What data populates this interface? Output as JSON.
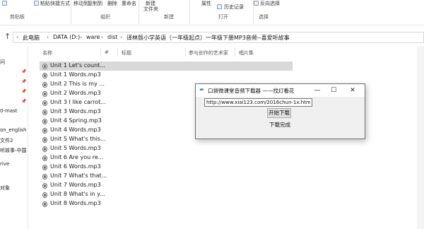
{
  "ribbon": {
    "paste_shortcut": "粘贴快捷方式",
    "move_to": "移动到",
    "copy_to": "复制到",
    "delete": "删除",
    "rename": "重命名",
    "new_folder_1": "新建",
    "new_folder_2": "文件夹",
    "properties": "属性",
    "history": "历史记录",
    "invert_select": "反向选择",
    "groups": {
      "clipboard": "剪贴板",
      "organize": "组织",
      "new": "新建",
      "open": "打开",
      "select": "选择"
    }
  },
  "address": {
    "crumbs": [
      "此电脑",
      "DATA (D:)",
      "ware",
      "dist",
      "译林版小学英语（一年级起点）一年级下册MP3音频--喜爱听故事"
    ]
  },
  "nav": {
    "items": [
      "问",
      "0-mast",
      "on_english",
      "文件2",
      "听故事-中国",
      "rive",
      "对象"
    ]
  },
  "columns": {
    "name": "名称",
    "number": "#",
    "title": "标题",
    "artist": "参与创作的艺术家",
    "album": "唱片集"
  },
  "files": [
    "Unit 1 Let's count...",
    "Unit 1 Words.mp3",
    "Unit 2 This is my ...",
    "Unit 2 Words.mp3",
    "Unit 3 I like carrot...",
    "Unit 3 Words.mp3",
    "Unit 4 Spring.mp3",
    "Unit 4 Words.mp3",
    "Unit 5 What's this...",
    "Unit 5 Words.mp3",
    "Unit 6 Are you re...",
    "Unit 6 Words.mp3",
    "Unit 7 What's that...",
    "Unit 7 Words.mp3",
    "Unit 8 What's in y...",
    "Unit 8 Words.mp3"
  ],
  "dialog": {
    "title": "口袋微课堂音频下载器 ——找灯看花",
    "minimize": "—",
    "maximize": "☐",
    "close": "✕",
    "url_value": "http://www.xiai123.com/2016chun-1x.html",
    "download_button": "开始下载",
    "status": "下载完成"
  },
  "colors": {
    "selected_row": "#d9d9d9",
    "dialog_bg": "#f0f0f0"
  }
}
